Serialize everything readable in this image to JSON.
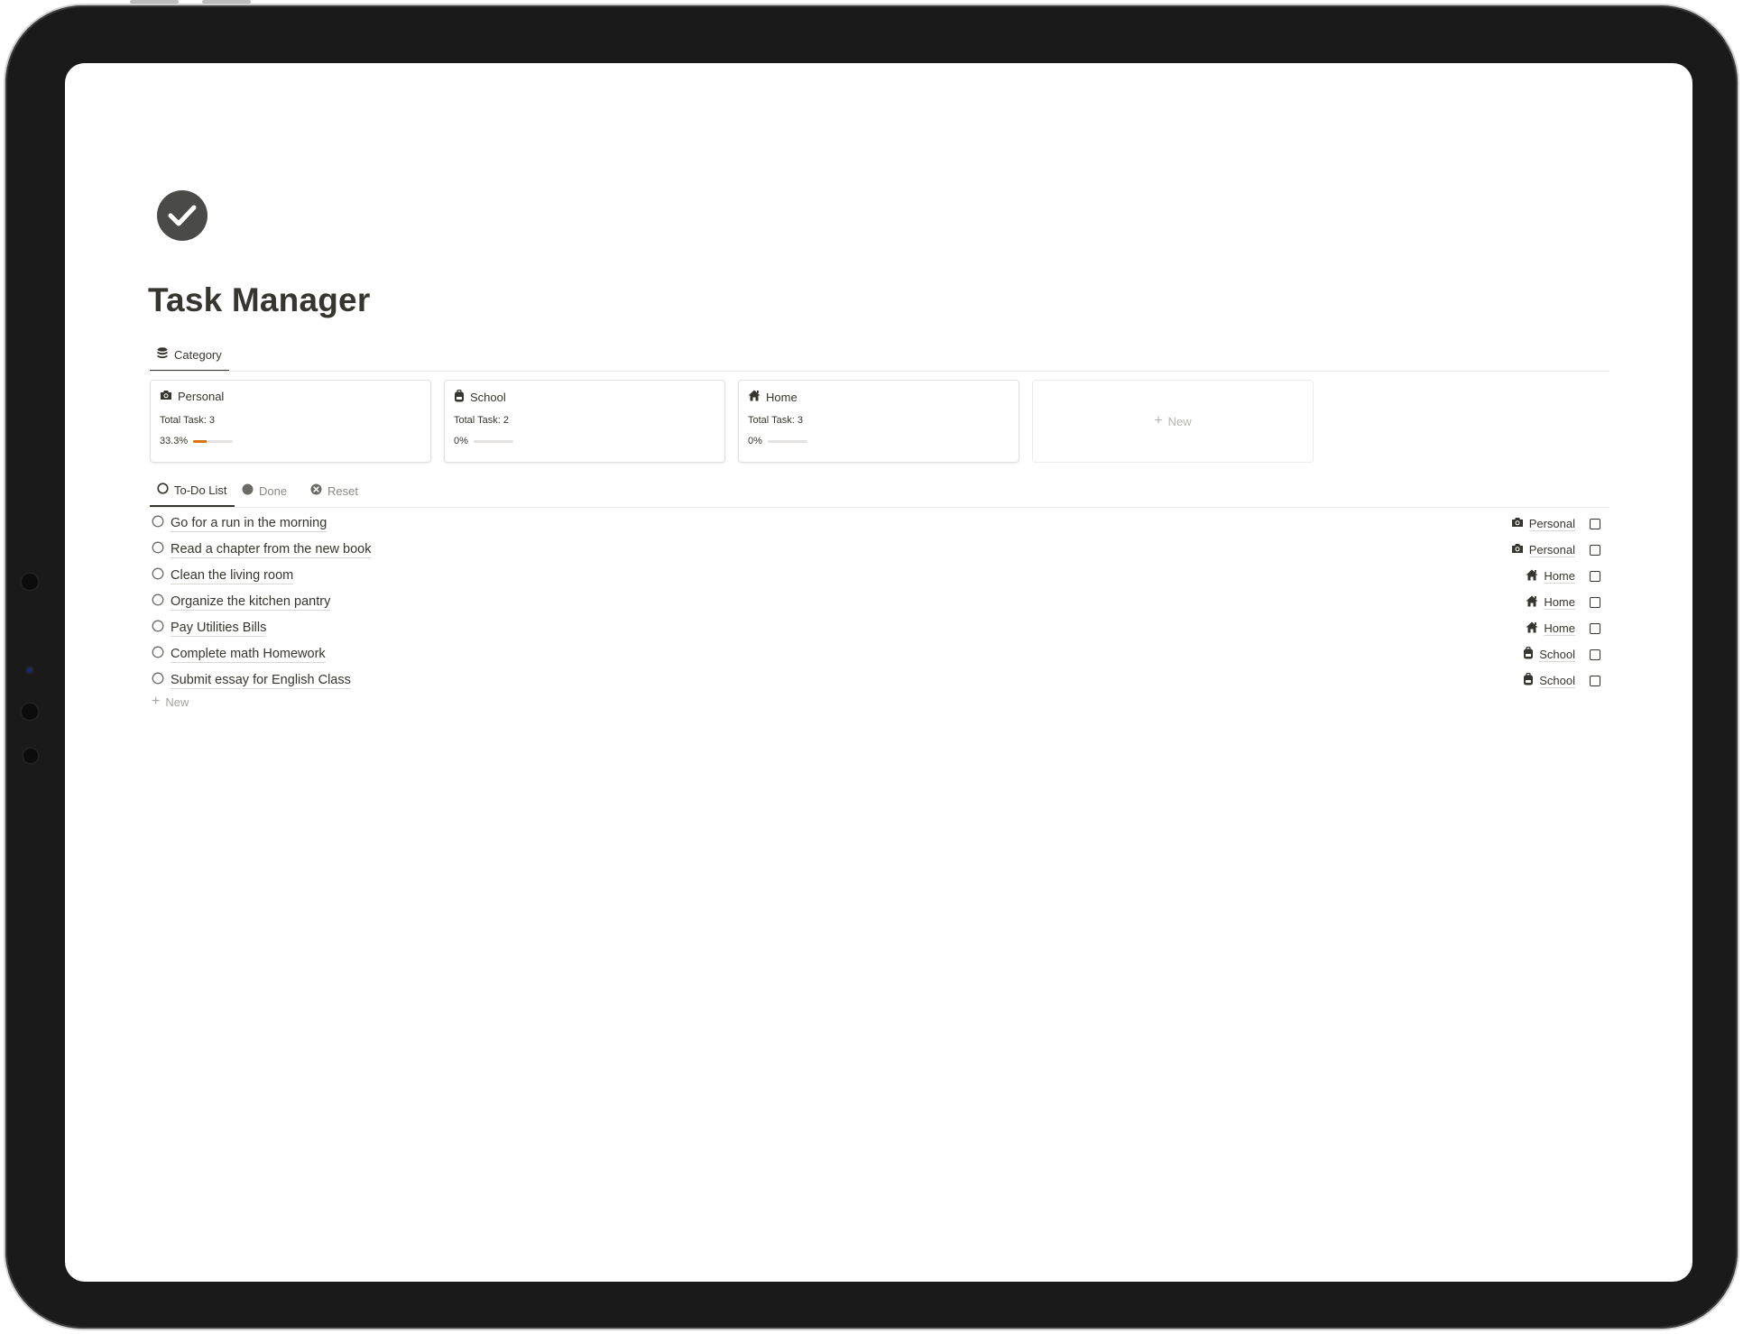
{
  "page": {
    "title": "Task Manager",
    "icon": "check-circle-icon"
  },
  "database_tab": {
    "label": "Category",
    "icon": "stack-icon"
  },
  "categories": [
    {
      "name": "Personal",
      "icon": "camera-icon",
      "total_label": "Total Task: 3",
      "progress_label": "33.3%",
      "progress": 0.333
    },
    {
      "name": "School",
      "icon": "backpack-icon",
      "total_label": "Total Task: 2",
      "progress_label": "0%",
      "progress": 0
    },
    {
      "name": "Home",
      "icon": "house-icon",
      "total_label": "Total Task: 3",
      "progress_label": "0%",
      "progress": 0
    }
  ],
  "new_card": {
    "label": "New"
  },
  "views": [
    {
      "label": "To-Do List",
      "icon": "empty-circle-icon",
      "active": true
    },
    {
      "label": "Done",
      "icon": "filled-circle-icon",
      "active": false
    },
    {
      "label": "Reset",
      "icon": "x-circle-icon",
      "active": false
    }
  ],
  "tasks": [
    {
      "title": "Go for a run in the morning",
      "category": "Personal",
      "category_icon": "camera-icon",
      "done": false
    },
    {
      "title": "Read a chapter from the new book",
      "category": "Personal",
      "category_icon": "camera-icon",
      "done": false
    },
    {
      "title": "Clean the living room",
      "category": "Home",
      "category_icon": "house-icon",
      "done": false
    },
    {
      "title": "Organize the kitchen pantry",
      "category": "Home",
      "category_icon": "house-icon",
      "done": false
    },
    {
      "title": "Pay Utilities Bills",
      "category": "Home",
      "category_icon": "house-icon",
      "done": false
    },
    {
      "title": "Complete math Homework",
      "category": "School",
      "category_icon": "backpack-icon",
      "done": false
    },
    {
      "title": "Submit essay for English Class",
      "category": "School",
      "category_icon": "backpack-icon",
      "done": false
    }
  ],
  "new_row": {
    "label": "New"
  },
  "colors": {
    "text": "#37352f",
    "progress": "#d9730d",
    "muted": "#8a8984"
  }
}
